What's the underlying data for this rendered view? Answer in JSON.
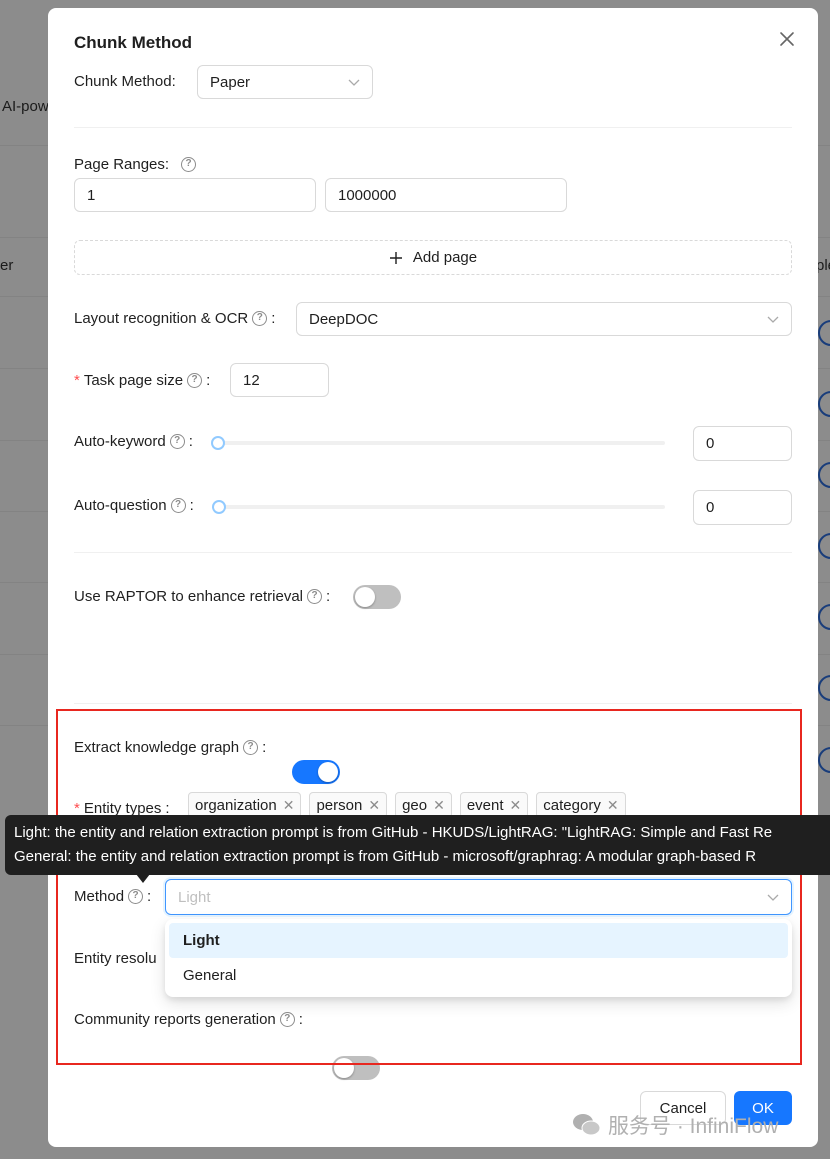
{
  "background": {
    "partial_text_1": "AI-pow",
    "partial_text_2": "er",
    "partial_text_3": "ple"
  },
  "modal": {
    "title": "Chunk Method",
    "chunk_method": {
      "label": "Chunk Method",
      "value": "Paper"
    },
    "page_ranges": {
      "label": "Page Ranges:",
      "from": "1",
      "to": "1000000",
      "add_label": "Add page"
    },
    "layout": {
      "label": "Layout recognition & OCR",
      "value": "DeepDOC"
    },
    "task_page_size": {
      "label": "Task page size",
      "value": "12"
    },
    "auto_keyword": {
      "label": "Auto-keyword",
      "value": "0"
    },
    "auto_question": {
      "label": "Auto-question",
      "value": "0"
    },
    "raptor": {
      "label": "Use RAPTOR to enhance retrieval",
      "enabled": false
    },
    "knowledge_graph": {
      "label": "Extract knowledge graph",
      "enabled": true
    },
    "entity_types": {
      "label": "Entity types",
      "tags": [
        "organization",
        "person",
        "geo",
        "event",
        "category"
      ]
    },
    "tooltip": {
      "line1": "Light: the entity and relation extraction prompt is from GitHub - HKUDS/LightRAG: \"LightRAG: Simple and Fast Re",
      "line2": "General: the entity and relation extraction prompt is from GitHub - microsoft/graphrag: A modular graph-based R"
    },
    "method": {
      "label": "Method",
      "placeholder": "Light",
      "options": [
        "Light",
        "General"
      ],
      "selected": "Light"
    },
    "entity_resolution": {
      "label": "Entity resolu"
    },
    "community_reports": {
      "label": "Community reports generation",
      "enabled": false
    },
    "buttons": {
      "cancel": "Cancel",
      "ok": "OK"
    }
  },
  "watermark": {
    "text": "服务号 · InfiniFlow"
  },
  "colors": {
    "primary": "#1677ff",
    "highlight_box": "#e8271f",
    "required": "#ff4d4f"
  }
}
